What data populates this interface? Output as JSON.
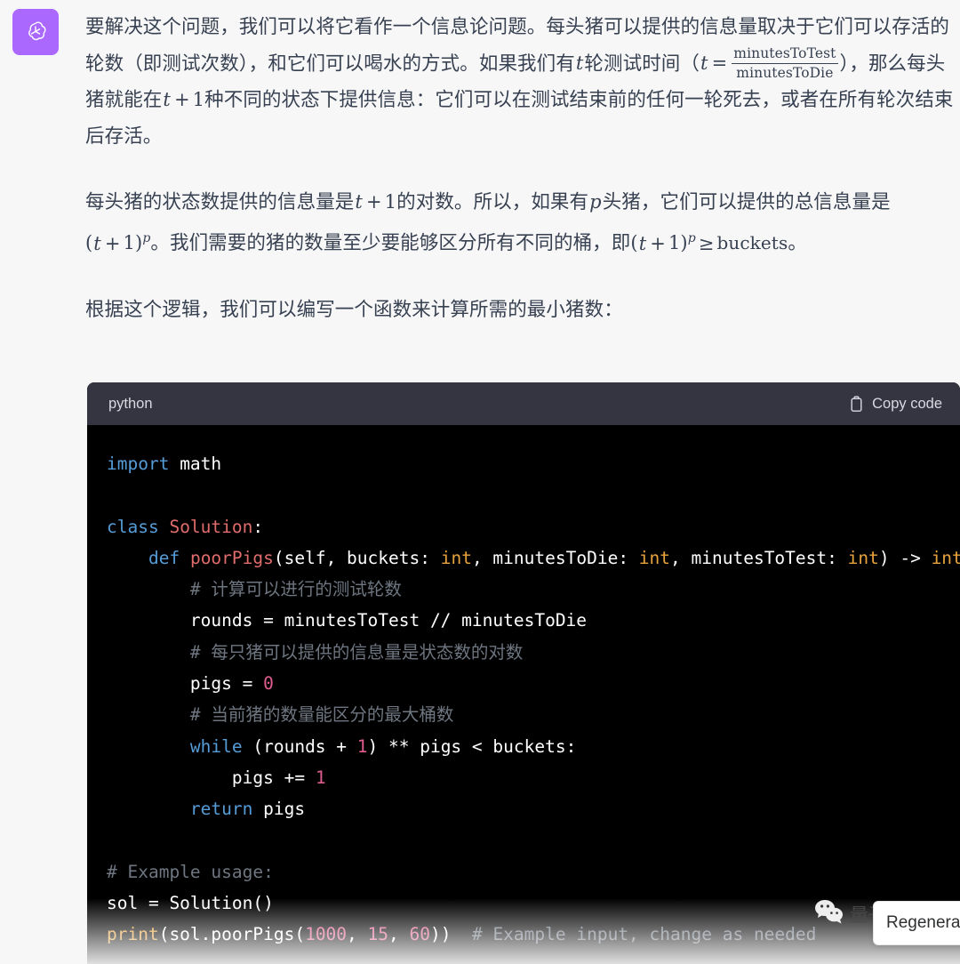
{
  "avatar": {
    "icon": "openai-logo-icon",
    "background": "#ab68ff"
  },
  "colors": {
    "page_background": "#f7f7f8",
    "body_text": "#374151",
    "code_header_background": "#343541",
    "code_background": "#000000",
    "keyword": "#569cd6",
    "function_name": "#e06c6c",
    "type": "#e8a33d",
    "number": "#e05d8f",
    "comment": "#6e7681"
  },
  "paragraphs": {
    "p1": {
      "s1": "要解决这个问题，我们可以将它看作一个信息论问题。每头猪可以提供的信息量取决于它们可以存活的轮数（即测试次数），和它们可以喝水的方式。如果我们有",
      "m1": "t",
      "s2": "轮测试时间（",
      "m2": "t",
      "m3": "=",
      "frac_num": "minutesToTest",
      "frac_den": "minutesToDie",
      "s3": "），那么每头猪就能在",
      "m4": "t",
      "m5": "+",
      "m6": "1",
      "s4": "种不同的状态下提供信息：它们可以在测试结束前的任何一轮死去，或者在所有轮次结束后存活。"
    },
    "p2": {
      "s1": "每头猪的状态数提供的信息量是",
      "m1": "t",
      "m2": "+",
      "m3": "1",
      "s2": "的对数。所以，如果有",
      "m4": "p",
      "s3": "头猪，它们可以提供的总信息量是",
      "m5": "(",
      "m6": "t",
      "m7": "+",
      "m8": "1",
      "m9": ")",
      "m10": "p",
      "s4": "。我们需要的猪的数量至少要能够区分所有不同的桶，即",
      "m11": "(",
      "m12": "t",
      "m13": "+",
      "m14": "1",
      "m15": ")",
      "m16": "p",
      "m17": "≥",
      "s5": "buckets",
      "s6": "。"
    },
    "p3": {
      "s1": "根据这个逻辑，我们可以编写一个函数来计算所需的最小猪数："
    }
  },
  "code_block": {
    "language": "python",
    "copy_label": "Copy code",
    "copy_icon": "clipboard-icon",
    "lines": [
      {
        "tokens": [
          {
            "t": "import",
            "c": "k"
          },
          {
            "t": " math",
            "c": "pl"
          }
        ]
      },
      {
        "tokens": []
      },
      {
        "tokens": [
          {
            "t": "class",
            "c": "k"
          },
          {
            "t": " ",
            "c": "pl"
          },
          {
            "t": "Solution",
            "c": "fn"
          },
          {
            "t": ":",
            "c": "pl"
          }
        ]
      },
      {
        "tokens": [
          {
            "t": "    ",
            "c": "pl"
          },
          {
            "t": "def",
            "c": "k"
          },
          {
            "t": " ",
            "c": "pl"
          },
          {
            "t": "poorPigs",
            "c": "fn"
          },
          {
            "t": "(self, buckets: ",
            "c": "pl"
          },
          {
            "t": "int",
            "c": "ty"
          },
          {
            "t": ", minutesToDie: ",
            "c": "pl"
          },
          {
            "t": "int",
            "c": "ty"
          },
          {
            "t": ", minutesToTest: ",
            "c": "pl"
          },
          {
            "t": "int",
            "c": "ty"
          },
          {
            "t": ") -> ",
            "c": "pl"
          },
          {
            "t": "int",
            "c": "ty"
          },
          {
            "t": ":",
            "c": "pl"
          }
        ]
      },
      {
        "tokens": [
          {
            "t": "        # 计算可以进行的测试轮数",
            "c": "cm"
          }
        ]
      },
      {
        "tokens": [
          {
            "t": "        rounds = minutesToTest // minutesToDie",
            "c": "pl"
          }
        ]
      },
      {
        "tokens": [
          {
            "t": "        # 每只猪可以提供的信息量是状态数的对数",
            "c": "cm"
          }
        ]
      },
      {
        "tokens": [
          {
            "t": "        pigs = ",
            "c": "pl"
          },
          {
            "t": "0",
            "c": "nu"
          }
        ]
      },
      {
        "tokens": [
          {
            "t": "        # 当前猪的数量能区分的最大桶数",
            "c": "cm"
          }
        ]
      },
      {
        "tokens": [
          {
            "t": "        ",
            "c": "pl"
          },
          {
            "t": "while",
            "c": "k"
          },
          {
            "t": " (rounds + ",
            "c": "pl"
          },
          {
            "t": "1",
            "c": "nu"
          },
          {
            "t": ") ** pigs < buckets:",
            "c": "pl"
          }
        ]
      },
      {
        "tokens": [
          {
            "t": "            pigs += ",
            "c": "pl"
          },
          {
            "t": "1",
            "c": "nu"
          }
        ]
      },
      {
        "tokens": [
          {
            "t": "        ",
            "c": "pl"
          },
          {
            "t": "return",
            "c": "k"
          },
          {
            "t": " pigs",
            "c": "pl"
          }
        ]
      },
      {
        "tokens": []
      },
      {
        "tokens": [
          {
            "t": "# Example usage:",
            "c": "cm"
          }
        ]
      },
      {
        "tokens": [
          {
            "t": "sol = Solution()",
            "c": "pl"
          }
        ]
      },
      {
        "tokens": [
          {
            "t": "print",
            "c": "bi"
          },
          {
            "t": "(sol.poorPigs(",
            "c": "pl"
          },
          {
            "t": "1000",
            "c": "nu"
          },
          {
            "t": ", ",
            "c": "pl"
          },
          {
            "t": "15",
            "c": "nu"
          },
          {
            "t": ", ",
            "c": "pl"
          },
          {
            "t": "60",
            "c": "nu"
          },
          {
            "t": ")) ",
            "c": "pl"
          },
          {
            "t": " # Example input, change as needed",
            "c": "cm"
          }
        ]
      }
    ]
  },
  "watermark": {
    "icon": "wechat-icon",
    "label": "量子位"
  },
  "float_box": {
    "label": "Regenerate"
  }
}
